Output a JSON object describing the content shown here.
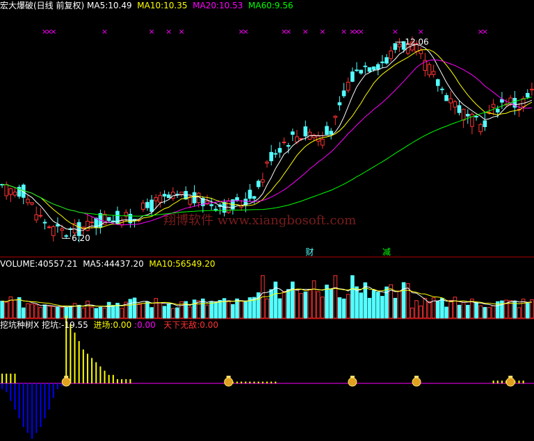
{
  "colors": {
    "up": "#ff3333",
    "down": "#54ffff",
    "ma5": "#ffffff",
    "ma10": "#ffff00",
    "ma20": "#ff00ff",
    "ma60": "#00ff00",
    "sep": "#b00000",
    "star": "#ff00ff",
    "dig_pos": "#ffff00",
    "dig_neg": "#0000ff",
    "baseline": "#ff00ff"
  },
  "header_price": {
    "title": "宏大爆破(日线 前复权)",
    "ma5_label": "MA5:",
    "ma5_value": "10.49",
    "ma10_label": "MA10:",
    "ma10_value": "10.35",
    "ma20_label": "MA20:",
    "ma20_value": "10.53",
    "ma60_label": "MA60:",
    "ma60_value": "9.56"
  },
  "header_volume": {
    "volume_label": "VOLUME:",
    "volume_value": "40557.21",
    "ma5_label": "MA5:",
    "ma5_value": "44437.20",
    "ma10_label": "MA10:",
    "ma10_value": "56549.20"
  },
  "header_indicator": {
    "name": "挖坑种树X",
    "dig_label": "挖坑:",
    "dig_value": "-19.55",
    "enter_label": "进场:",
    "enter_value": "0.00",
    "sep": ":",
    "extra_value": "0.00",
    "invincible_label": "天下无敌:",
    "invincible_value": "0.00"
  },
  "annotations": {
    "high_label": "12.06",
    "low_label": "6.20",
    "watermark": "翔博软件 www.xiangbosoft.com",
    "signal_cai": "财",
    "signal_jian": "减"
  },
  "chart_data": [
    {
      "type": "candlestick",
      "title": "宏大爆破(日线 前复权)",
      "ylim": [
        5.5,
        12.8
      ],
      "series": [
        {
          "name": "MA5"
        },
        {
          "name": "MA10"
        },
        {
          "name": "MA20"
        },
        {
          "name": "MA60"
        }
      ],
      "high_marker": 12.06,
      "low_marker": 6.2,
      "star_marker_candles": [
        10,
        11,
        12,
        24,
        35,
        39,
        42,
        56,
        57,
        66,
        67,
        71,
        75,
        80,
        82,
        83,
        84,
        92,
        98,
        112,
        113
      ]
    },
    {
      "type": "bar",
      "title": "VOLUME",
      "ylim": [
        0,
        100000
      ]
    },
    {
      "type": "bar",
      "title": "挖坑种树X",
      "ylim": [
        -20,
        18
      ],
      "dig_values": [
        -2,
        -3,
        -6,
        -9,
        -12,
        -15,
        -17,
        -19,
        -17,
        -15,
        -12,
        -9,
        -5,
        -2,
        -1,
        -1
      ],
      "plant_values": [
        16,
        14,
        12,
        10,
        8,
        7,
        6,
        5,
        4,
        3,
        2,
        2,
        1,
        1,
        1,
        1
      ],
      "post_values": [
        1,
        1,
        1,
        1,
        1,
        1,
        1,
        1,
        1,
        1,
        1,
        1
      ],
      "coin_marker_candles": [
        15,
        53,
        82,
        97,
        119
      ]
    }
  ]
}
